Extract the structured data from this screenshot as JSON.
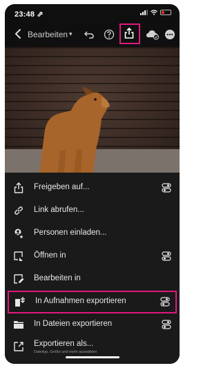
{
  "status_bar": {
    "time": "23:48 ⇗"
  },
  "toolbar": {
    "edit_label": "Bearbeiten",
    "dropdown_glyph": "▾"
  },
  "menu": {
    "items": [
      {
        "label": "Freigeben auf...",
        "icon": "share-icon",
        "has_settings": true
      },
      {
        "label": "Link abrufen...",
        "icon": "link-icon",
        "has_settings": false
      },
      {
        "label": "Personen einladen...",
        "icon": "add-person-icon",
        "has_settings": false
      },
      {
        "label": "Öffnen in",
        "icon": "open-in-icon",
        "has_settings": true
      },
      {
        "label": "Bearbeiten in",
        "icon": "edit-in-icon",
        "has_settings": false
      },
      {
        "label": "In Aufnahmen exportieren",
        "icon": "camera-roll-export-icon",
        "has_settings": true,
        "highlighted": true
      },
      {
        "label": "In Dateien exportieren",
        "icon": "folder-icon",
        "has_settings": true
      },
      {
        "label": "Exportieren als...",
        "sublabel": "Dateityp, Größe und mehr auswählen",
        "icon": "export-as-icon",
        "has_settings": false
      }
    ]
  },
  "colors": {
    "highlight": "#e0197d",
    "background": "#0f0f0f",
    "sheet": "#1a1a1a"
  }
}
